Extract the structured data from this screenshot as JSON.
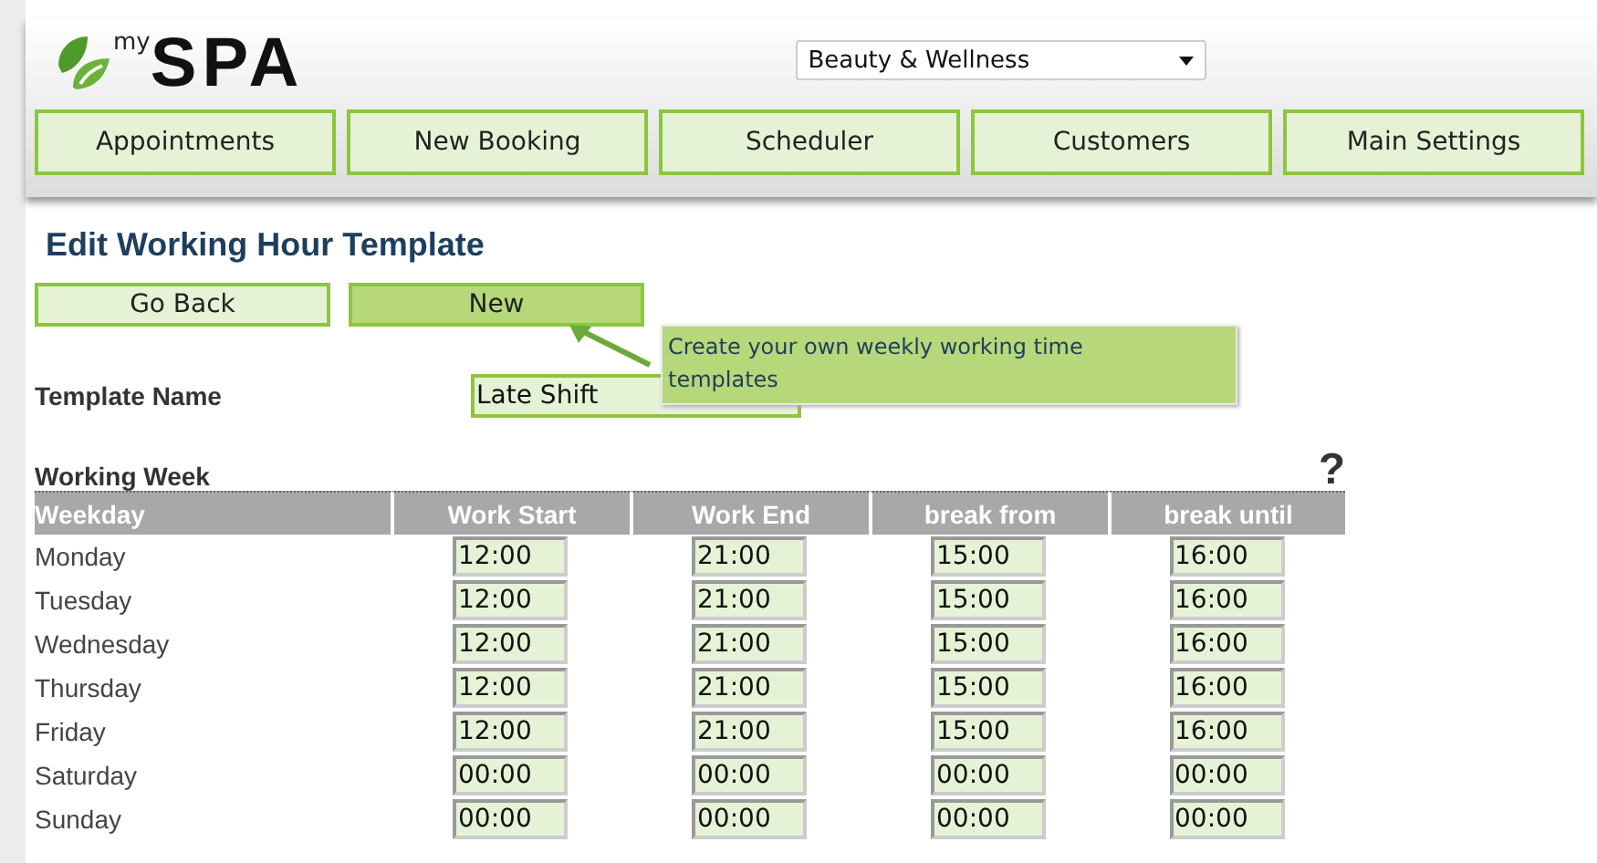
{
  "logo": {
    "superscript": "my",
    "name": "SPA"
  },
  "business_select": {
    "value": "Beauty & Wellness"
  },
  "nav": [
    {
      "label": "Appointments"
    },
    {
      "label": "New Booking"
    },
    {
      "label": "Scheduler"
    },
    {
      "label": "Customers"
    },
    {
      "label": "Main Settings"
    }
  ],
  "page_title": "Edit Working Hour Template",
  "actions": [
    {
      "label": "Go Back",
      "selected": false
    },
    {
      "label": "New",
      "selected": true
    }
  ],
  "tooltip": "Create your own weekly working time templates",
  "template_name": {
    "label": "Template Name",
    "value": "Late Shift"
  },
  "working_week": {
    "title": "Working Week",
    "help": "?",
    "columns": [
      "Weekday",
      "Work Start",
      "Work End",
      "break from",
      "break until"
    ],
    "rows": [
      {
        "day": "Monday",
        "times": [
          "12:00",
          "21:00",
          "15:00",
          "16:00"
        ]
      },
      {
        "day": "Tuesday",
        "times": [
          "12:00",
          "21:00",
          "15:00",
          "16:00"
        ]
      },
      {
        "day": "Wednesday",
        "times": [
          "12:00",
          "21:00",
          "15:00",
          "16:00"
        ]
      },
      {
        "day": "Thursday",
        "times": [
          "12:00",
          "21:00",
          "15:00",
          "16:00"
        ]
      },
      {
        "day": "Friday",
        "times": [
          "12:00",
          "21:00",
          "15:00",
          "16:00"
        ]
      },
      {
        "day": "Saturday",
        "times": [
          "00:00",
          "00:00",
          "00:00",
          "00:00"
        ]
      },
      {
        "day": "Sunday",
        "times": [
          "00:00",
          "00:00",
          "00:00",
          "00:00"
        ]
      }
    ]
  }
}
